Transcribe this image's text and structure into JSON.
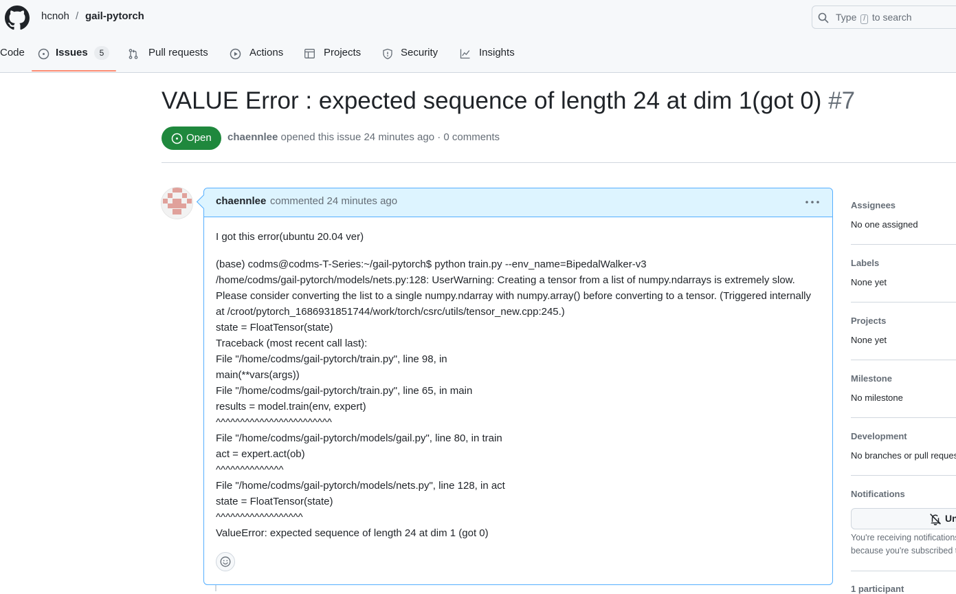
{
  "header": {
    "owner": "hcnoh",
    "separator": "/",
    "repo": "gail-pytorch",
    "search": {
      "prefix": "Type",
      "key": "/",
      "suffix": "to search"
    }
  },
  "nav": {
    "code": "Code",
    "issues": "Issues",
    "issues_count": "5",
    "pull_requests": "Pull requests",
    "actions": "Actions",
    "projects": "Projects",
    "security": "Security",
    "insights": "Insights"
  },
  "issue": {
    "title": "VALUE Error : expected sequence of length 24 at dim 1(got 0)",
    "number": "#7",
    "state": "Open",
    "author": "chaennlee",
    "opened_text": "opened this issue 24 minutes ago · 0 comments"
  },
  "comment": {
    "author": "chaennlee",
    "when": "commented 24 minutes ago",
    "intro": "I got this error(ubuntu 20.04 ver)",
    "lines": [
      "(base) codms@codms-T-Series:~/gail-pytorch$ python train.py --env_name=BipedalWalker-v3",
      "/home/codms/gail-pytorch/models/nets.py:128: UserWarning: Creating a tensor from a list of numpy.ndarrays is extremely slow.",
      "Please consider converting the list to a single numpy.ndarray with numpy.array() before converting to a tensor. (Triggered internally at /croot/pytorch_1686931851744/work/torch/csrc/utils/tensor_new.cpp:245.)",
      "state = FloatTensor(state)",
      "Traceback (most recent call last):",
      "File \"/home/codms/gail-pytorch/train.py\", line 98, in",
      "main(**vars(args))",
      "File \"/home/codms/gail-pytorch/train.py\", line 65, in main",
      "results = model.train(env, expert)",
      "^^^^^^^^^^^^^^^^^^^^^^^^",
      "File \"/home/codms/gail-pytorch/models/gail.py\", line 80, in train",
      "act = expert.act(ob)",
      "^^^^^^^^^^^^^^",
      "File \"/home/codms/gail-pytorch/models/nets.py\", line 128, in act",
      "state = FloatTensor(state)",
      "^^^^^^^^^^^^^^^^^^",
      "ValueError: expected sequence of length 24 at dim 1 (got 0)"
    ]
  },
  "sidebar": {
    "assignees": {
      "heading": "Assignees",
      "value": "No one assigned"
    },
    "labels": {
      "heading": "Labels",
      "value": "None yet"
    },
    "projects": {
      "heading": "Projects",
      "value": "None yet"
    },
    "milestone": {
      "heading": "Milestone",
      "value": "No milestone"
    },
    "development": {
      "heading": "Development",
      "value": "No branches or pull requests"
    },
    "notifications": {
      "heading": "Notifications",
      "button": "Unsubscribe",
      "note": "You're receiving notifications because you're subscribed to this thread."
    },
    "participants": "1 participant"
  },
  "colors": {
    "open_green": "#1f883d",
    "comment_header": "#ddf4ff",
    "comment_border": "#54aeff",
    "tab_underline": "#fd8c73"
  }
}
